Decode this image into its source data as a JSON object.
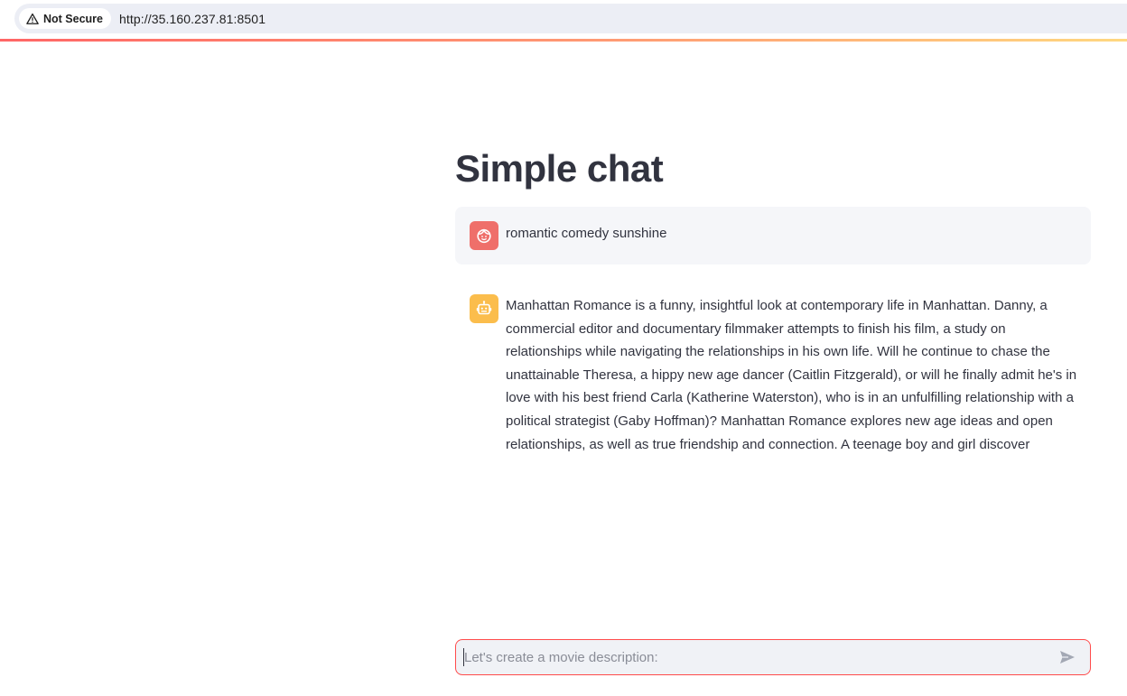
{
  "browser": {
    "security_label": "Not Secure",
    "url": "http://35.160.237.81:8501"
  },
  "page": {
    "title": "Simple chat"
  },
  "messages": [
    {
      "role": "user",
      "avatar_icon": "user-face-icon",
      "avatar_color": "#ef6f6a",
      "text": "romantic comedy sunshine"
    },
    {
      "role": "assistant",
      "avatar_icon": "robot-icon",
      "avatar_color": "#fbbd4c",
      "text": "Manhattan Romance is a funny, insightful look at contemporary life in Manhattan. Danny, a commercial editor and documentary filmmaker attempts to finish his film, a study on relationships while navigating the relationships in his own life. Will he continue to chase the unattainable Theresa, a hippy new age dancer (Caitlin Fitzgerald), or will he finally admit he's in love with his best friend Carla (Katherine Waterston), who is in an unfulfilling relationship with a political strategist (Gaby Hoffman)? Manhattan Romance explores new age ideas and open relationships, as well as true friendship and connection. A teenage boy and girl discover"
    }
  ],
  "chat_input": {
    "placeholder": "Let's create a movie description:",
    "value": ""
  },
  "colors": {
    "accent": "#ff4b4b",
    "text": "#31333f",
    "user_bubble_bg": "#f5f6f9",
    "input_bg": "#f0f2f6"
  }
}
